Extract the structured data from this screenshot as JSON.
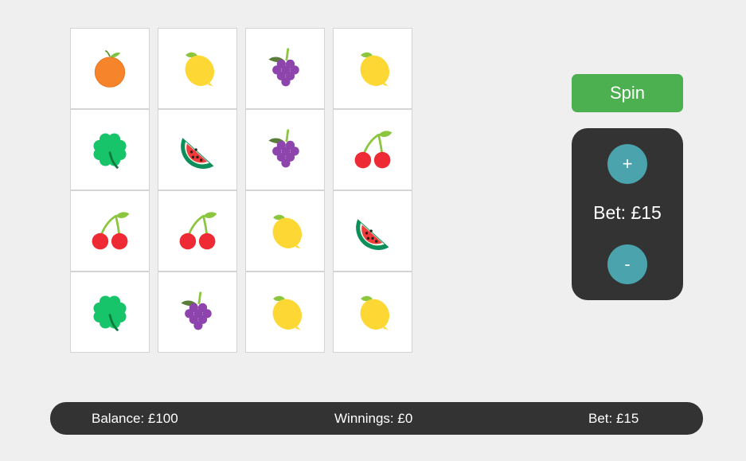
{
  "reels": [
    [
      "orange",
      "clover",
      "cherry",
      "clover"
    ],
    [
      "lemon",
      "watermelon",
      "cherry",
      "grapes"
    ],
    [
      "grapes",
      "grapes",
      "lemon",
      "lemon"
    ],
    [
      "lemon",
      "cherry",
      "watermelon",
      "lemon"
    ]
  ],
  "controls": {
    "spin_label": "Spin",
    "plus_label": "+",
    "minus_label": "-",
    "bet_label": "Bet: £15"
  },
  "status": {
    "balance": "Balance: £100",
    "winnings": "Winnings: £0",
    "bet": "Bet: £15"
  },
  "colors": {
    "spin_button": "#4caf50",
    "panel": "#333333",
    "bet_buttons": "#4aa3ad"
  }
}
